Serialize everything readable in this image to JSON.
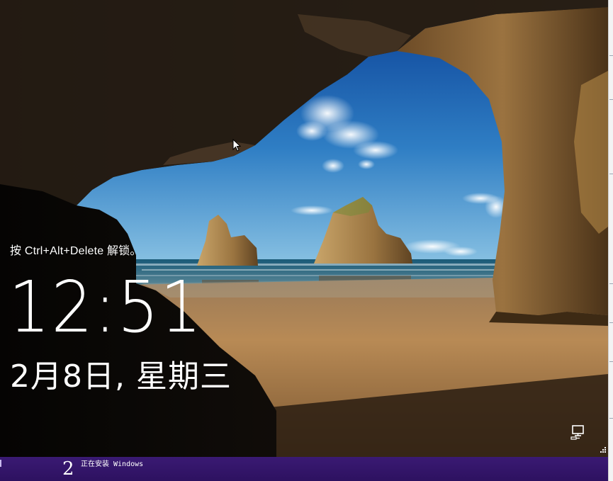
{
  "lock_screen": {
    "hint": "按 Ctrl+Alt+Delete 解锁。",
    "time": "12:51",
    "date": "2月8日, 星期三"
  },
  "tray": {
    "network_icon": "network-monitor-icon"
  },
  "status_bar": {
    "step_number": "2",
    "step_text": "正在安装 Windows"
  },
  "colors": {
    "sky_top": "#0d4aa3",
    "sky_bottom": "#5aa6d8",
    "sea": "#1d5f7a",
    "sand": "#b88a52",
    "cave_rock": "#3a2a1a",
    "status_bar": "#2f1363"
  }
}
